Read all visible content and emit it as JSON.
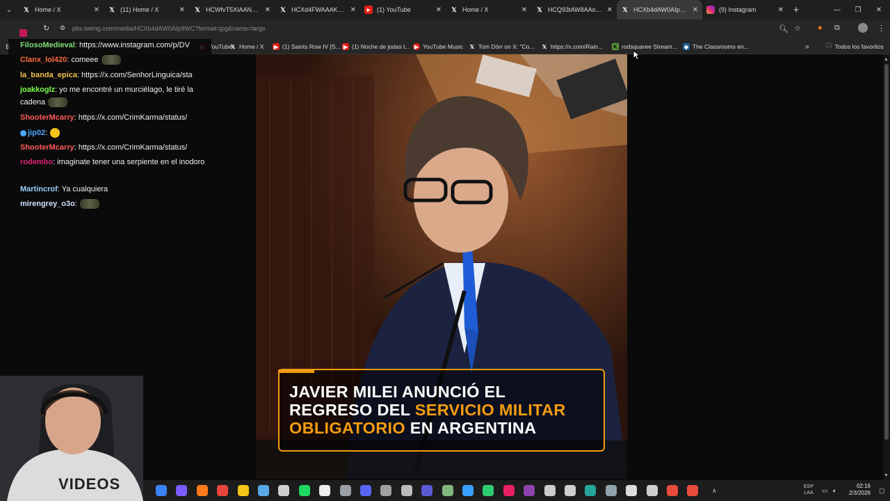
{
  "tabs": [
    {
      "title": "Home / X",
      "icon": "x-logo-icon"
    },
    {
      "title": "(11) Home / X",
      "icon": "x-logo-icon"
    },
    {
      "title": "HCWfvT5XIAANo9D",
      "icon": "x-logo-icon"
    },
    {
      "title": "HCXd4FWAAAK-L2",
      "icon": "x-logo-icon"
    },
    {
      "title": "(1) YouTube",
      "icon": "youtube-icon"
    },
    {
      "title": "Home / X",
      "icon": "x-logo-icon"
    },
    {
      "title": "HCQ93tAW8AAoqBF",
      "icon": "x-logo-icon"
    },
    {
      "title": "HCXb4dAW0AIp9WC",
      "icon": "x-logo-icon",
      "active": true
    },
    {
      "title": "(9) Instagram",
      "icon": "instagram-icon"
    }
  ],
  "address": {
    "url": "pbs.twimg.com/media/HCXb4dAW0AIp9WC?format=jpg&name=large"
  },
  "bookmarks": [
    {
      "label": "YouTube",
      "icon": "youtube-icon"
    },
    {
      "label": "Home / X",
      "icon": "x-logo-icon"
    },
    {
      "label": "(1) Saints Row IV [S...",
      "icon": "youtube-icon"
    },
    {
      "label": "(1) Noche de jodas t...",
      "icon": "youtube-icon"
    },
    {
      "label": "YouTube Music",
      "icon": "youtube-music-icon"
    },
    {
      "label": "Tom Dörr on X: \"Co...",
      "icon": "x-logo-icon"
    },
    {
      "label": "https://x.com/Rain...",
      "icon": "x-logo-icon"
    },
    {
      "label": "rodsquaree Stream...",
      "icon": "kick-icon"
    },
    {
      "label": "The Classrooms en...",
      "icon": "steam-icon"
    }
  ],
  "bookmarks_all": "Todos los favoritos",
  "chat": [
    {
      "user": "FilosoMedieval",
      "color": "#7fe07a",
      "text": ": https://www.instagram.com/p/DV"
    },
    {
      "user": "Clanx_lol420",
      "color": "#ff6a3d",
      "text": ": comeee",
      "emote": true
    },
    {
      "user": "la_banda_epica",
      "color": "#f2c14e",
      "text": ": https://x.com/SenhorLinguica/sta"
    },
    {
      "user": "joakkoglz",
      "color": "#7dff4e",
      "text": ": yo me encontré un murciélago, le tiré la cadena",
      "emote": true
    },
    {
      "user": "ShooterMcarry",
      "color": "#ff5a5a",
      "text": ": https://x.com/CrimKarma/status/"
    },
    {
      "user": "jip02",
      "color": "#4aa8ff",
      "text": ":",
      "emoji": true
    },
    {
      "user": "ShooterMcarry",
      "color": "#ff5a5a",
      "text": ": https://x.com/CrimKarma/status/"
    },
    {
      "user": "rodembo",
      "color": "#e0207a",
      "text": ": imaginate tener una serpiente en el inodoro"
    },
    {
      "user": "Martincrof",
      "color": "#9ad0ff",
      "text": ": Ya cualquiera"
    },
    {
      "user": "mirengrey_o3o",
      "color": "#d0e0ff",
      "text": ":",
      "emote": true
    }
  ],
  "headline": {
    "line1": "JAVIER MILEI ANUNCIÓ EL",
    "line2a": "REGRESO DEL ",
    "line2b": "SERVICIO MILITAR",
    "line3a": "OBLIGATORIO",
    "line3b": " EN ARGENTINA",
    "accent": "#f39c12"
  },
  "webcam_text": "VIDEOS",
  "taskbar": {
    "lang": "ESP",
    "lang2": "LAA",
    "time": "02:16",
    "date": "2/3/2026"
  }
}
